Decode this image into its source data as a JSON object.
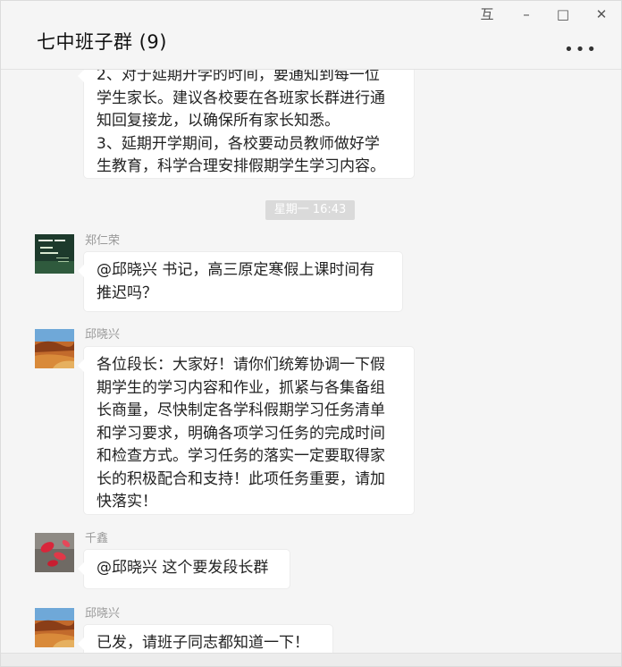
{
  "window": {
    "title": "七中班子群 (9)",
    "controls": {
      "pin": "互",
      "minimize": "–",
      "maximize": "□",
      "close": "✕"
    },
    "more_menu": "•••"
  },
  "messages": [
    {
      "sender": "",
      "lines": [
        "2、对于延期开学的时间，要通知到每一位",
        "学生家长。建议各校要在各班家长群进行通",
        "知回复接龙，以确保所有家长知悉。",
        "3、延期开学期间，各校要动员教师做好学",
        "生教育，科学合理安排假期学生学习内容。"
      ]
    },
    {
      "timestamp": "星期一 16:43"
    },
    {
      "sender": "郑仁荣",
      "avatar": "book-cover-avatar",
      "lines": [
        "@邱晓兴 书记，高三原定寒假上课时间有",
        "推迟吗？"
      ]
    },
    {
      "sender": "邱晓兴",
      "avatar": "landscape-avatar",
      "lines": [
        "各位段长：大家好！请你们统筹协调一下假",
        "期学生的学习内容和作业，抓紧与各集备组",
        "长商量，尽快制定各学科假期学习任务清单",
        "和学习要求，明确各项学习任务的完成时间",
        "和检查方式。学习任务的落实一定要取得家",
        "长的积极配合和支持！此项任务重要，请加",
        "快落实！"
      ]
    },
    {
      "sender": "千鑫",
      "avatar": "red-leaves-avatar",
      "lines": [
        "@邱晓兴 这个要发段长群"
      ]
    },
    {
      "sender": "邱晓兴",
      "avatar": "landscape-avatar",
      "lines": [
        "已发，请班子同志都知道一下！"
      ]
    }
  ],
  "colors": {
    "background": "#f5f5f5",
    "bubble": "#ffffff",
    "sender": "#9a9a9a"
  }
}
